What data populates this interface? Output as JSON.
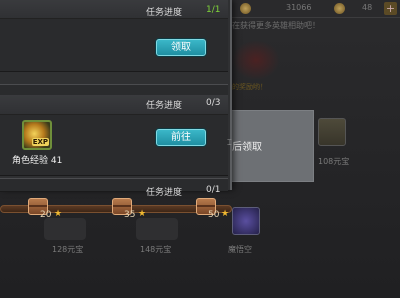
{
  "background": {
    "gold_amount": "31066",
    "gem_amount": "48",
    "plus_icon": "plus-icon",
    "notice_text": "在获得更多英雄相助吧！",
    "notice_text2": "的奖励哟！",
    "claim_box_text": "后领取",
    "rewards": [
      {
        "label": "108元宝"
      },
      {
        "label": "128元宝"
      },
      {
        "label": "148元宝"
      },
      {
        "label": "魔悟空"
      }
    ]
  },
  "tasks": [
    {
      "progress_label": "任务进度",
      "progress_value": "1/1",
      "value_color": "#7fd43a",
      "button_label": "领取"
    },
    {
      "progress_label": "任务进度",
      "progress_value": "0/3",
      "value_color": "#dcdcdc",
      "button_label": "前往",
      "reward": {
        "icon": "exp-icon",
        "badge": "EXP",
        "caption": "角色经验 41"
      }
    },
    {
      "progress_label": "任务进度",
      "progress_value": "0/1",
      "value_color": "#dcdcdc"
    }
  ],
  "milestones": [
    {
      "points": "20",
      "icon": "chest-icon"
    },
    {
      "points": "35",
      "icon": "chest-icon"
    },
    {
      "points": "50",
      "icon": "chest-icon"
    }
  ]
}
